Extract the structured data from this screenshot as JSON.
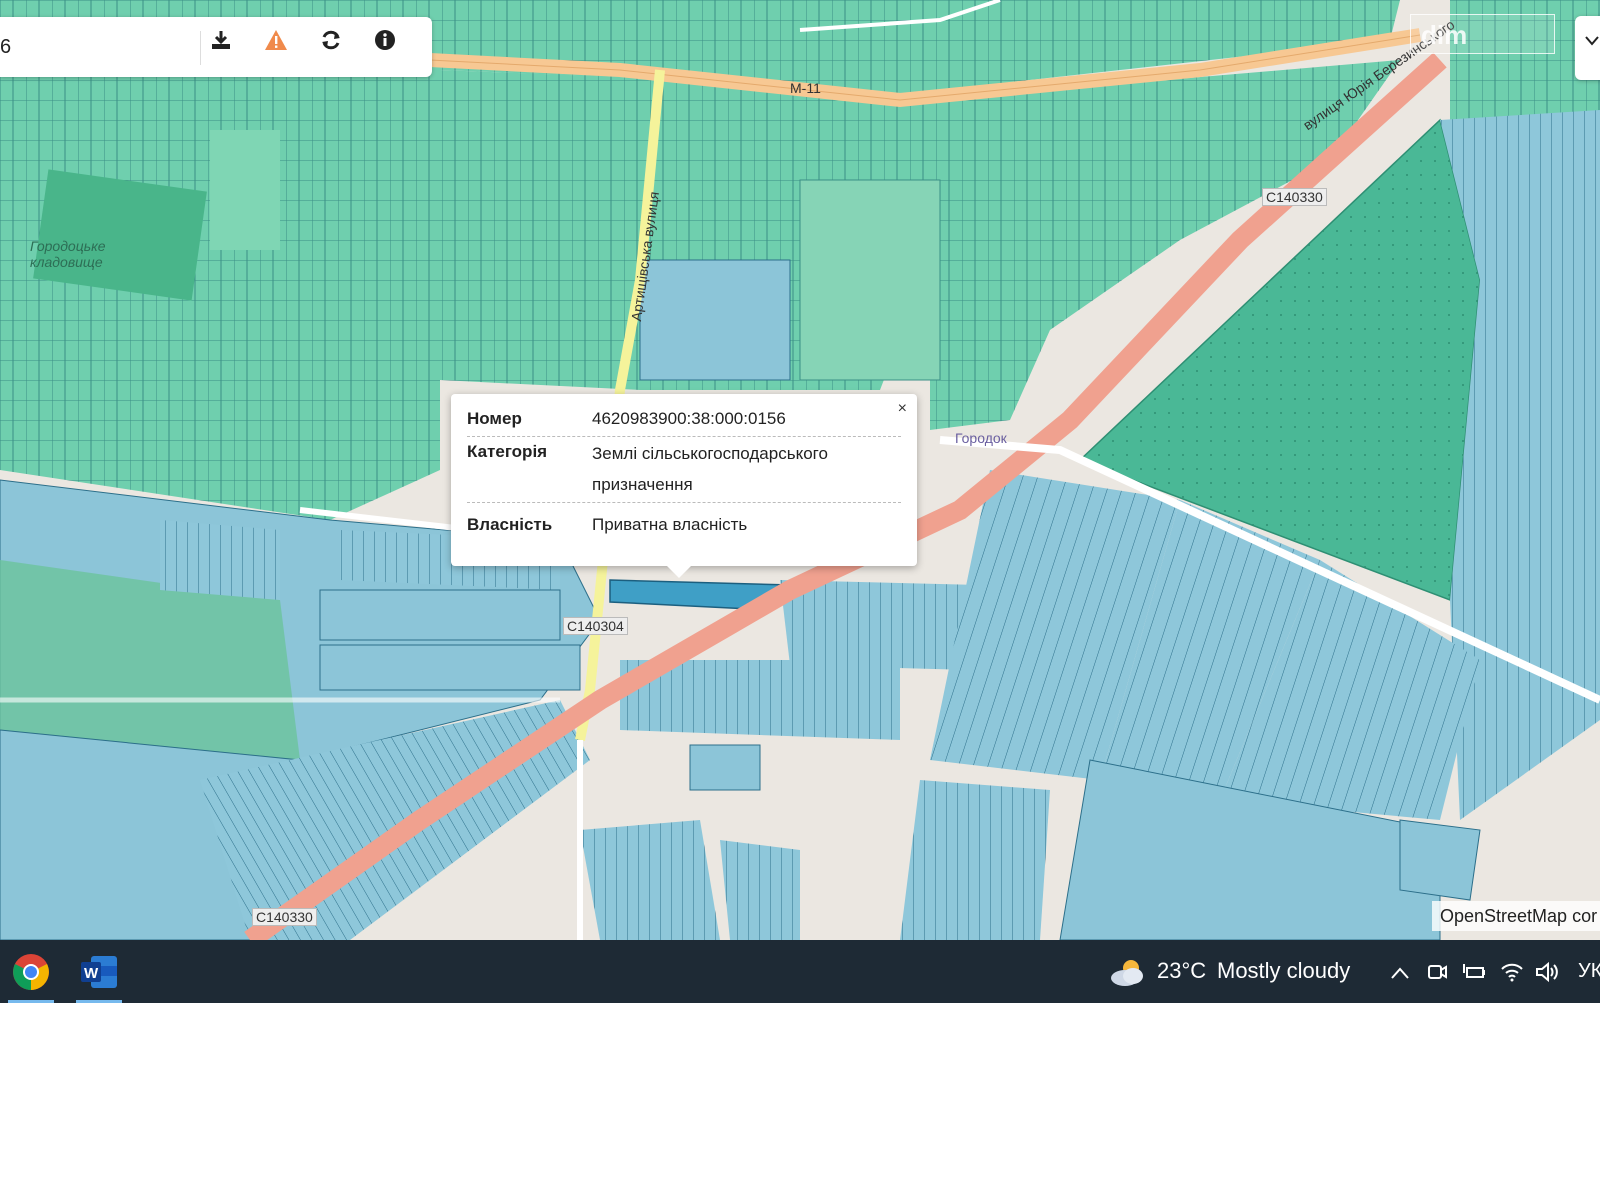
{
  "search": {
    "value": "6"
  },
  "toolbar": {
    "download_icon": "download-icon",
    "warning_icon": "warning-icon",
    "refresh_icon": "refresh-icon",
    "info_icon": "info-icon"
  },
  "logo": {
    "text": "dim"
  },
  "map_labels": {
    "m_road": "M-11",
    "road_top": "C140330",
    "road_bottom": "C140330",
    "road_mid": "C140304",
    "street_berezynskoho": "вулиця Юрія Березинського",
    "street_artyshchivska": "Артищівська вулиця",
    "cemetery": "Городоцьке кладовище",
    "town": "Городок"
  },
  "popup": {
    "rows": [
      {
        "label": "Номер",
        "value": "4620983900:38:000:0156"
      },
      {
        "label": "Категорія",
        "value": "Землі сільськогосподарського призначення"
      },
      {
        "label": "Власність",
        "value": "Приватна власність"
      }
    ],
    "close": "×"
  },
  "attribution": "OpenStreetMap cor",
  "taskbar": {
    "apps": [
      "chrome-icon",
      "word-icon"
    ],
    "weather": {
      "temp": "23°C",
      "desc": "Mostly cloudy"
    },
    "language": "УК"
  },
  "colors": {
    "parcel_green": "#5fc8a3",
    "parcel_blue": "#8cc5d8",
    "road_main": "#f0a18f",
    "road_secondary": "#f7c893",
    "taskbar_bg": "#1e2a35"
  }
}
